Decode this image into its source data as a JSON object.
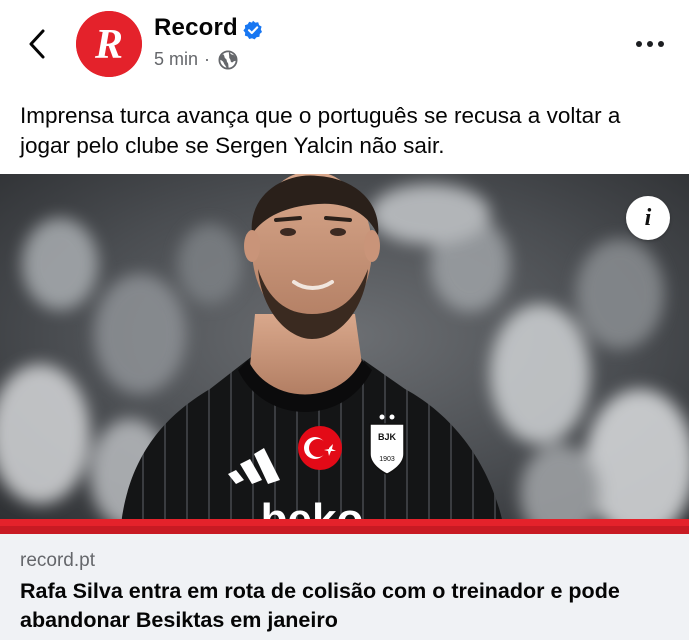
{
  "header": {
    "page_name": "Record",
    "time_ago": "5 min",
    "separator": "·",
    "audience_icon": "globe-icon",
    "avatar_letter": "R",
    "brand_color": "#e4222b",
    "verified_color": "#1877f2"
  },
  "post": {
    "text": "Imprensa turca avança que o português se recusa a voltar a jogar pelo clube se Sergen Yalcin não sair.",
    "image": {
      "shirt_sponsor": "beko",
      "crest_text": "BJK",
      "crest_year": "1903",
      "info_label": "i"
    }
  },
  "link_preview": {
    "domain": "record.pt",
    "title": "Rafa Silva entra em rota de colisão com o treinador e pode abandonar Besiktas em janeiro"
  }
}
